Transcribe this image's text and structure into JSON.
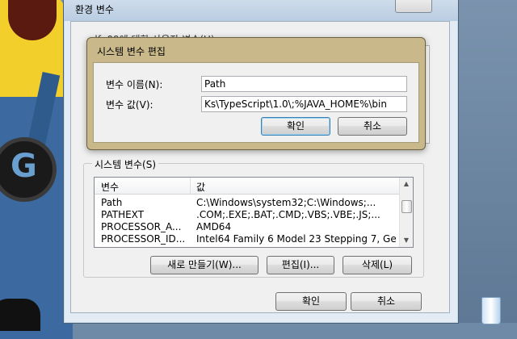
{
  "outer_window": {
    "title": "환경 변수",
    "user_group_label": "elfe09에 대한 사용자 변수(U)"
  },
  "edit_dialog": {
    "title": "시스템 변수 편집",
    "name_label": "변수 이름(N):",
    "name_value": "Path",
    "value_label": "변수 값(V):",
    "value_value": "Ks\\TypeScript\\1.0\\;%JAVA_HOME%\\bin",
    "ok_label": "확인",
    "cancel_label": "취소"
  },
  "system_vars": {
    "group_label": "시스템 변수(S)",
    "columns": [
      "변수",
      "값"
    ],
    "rows": [
      {
        "name": "Path",
        "value": "C:\\Windows\\system32;C:\\Windows;..."
      },
      {
        "name": "PATHEXT",
        "value": ".COM;.EXE;.BAT;.CMD;.VBS;.VBE;.JS;..."
      },
      {
        "name": "PROCESSOR_A...",
        "value": "AMD64"
      },
      {
        "name": "PROCESSOR_ID...",
        "value": "Intel64 Family 6 Model 23 Stepping 7, Ge"
      }
    ],
    "new_label": "새로 만들기(W)...",
    "edit_label": "편집(I)...",
    "delete_label": "삭제(L)"
  },
  "bottom_buttons": {
    "ok_label": "확인",
    "cancel_label": "취소"
  },
  "colors": {
    "dialog_frame": "#c9b98a",
    "window_frame": "#b9cde2",
    "default_button_border": "#3c7fb1"
  }
}
